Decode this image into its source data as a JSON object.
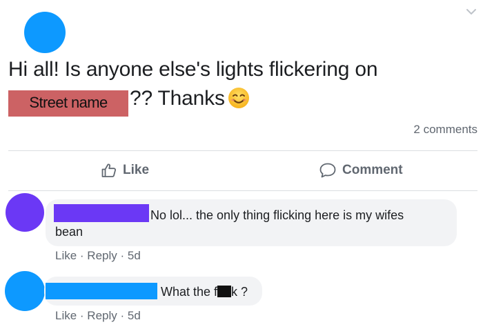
{
  "post": {
    "text_line1": "Hi all! Is anyone else's lights flickering on",
    "street_label": "Street name",
    "text_line2_suffix": "?? Thanks",
    "emoji_icon": "smiling-face-icon",
    "avatar_color": "#0d99ff",
    "comments_count_label": "2 comments"
  },
  "actions": {
    "like_label": "Like",
    "comment_label": "Comment"
  },
  "comments": [
    {
      "avatar_color": "#6b38f5",
      "name_redaction_color": "#6b38f5",
      "text_line1": "No lol... the only thing flicking here is my wifes",
      "text_line2": "bean",
      "like_label": "Like",
      "reply_label": "Reply",
      "age": "5d"
    },
    {
      "avatar_color": "#0d99ff",
      "name_redaction_color": "#0d99ff",
      "text_prefix": "What the f",
      "text_suffix": "k ?",
      "like_label": "Like",
      "reply_label": "Reply",
      "age": "5d"
    }
  ],
  "separator": " · "
}
